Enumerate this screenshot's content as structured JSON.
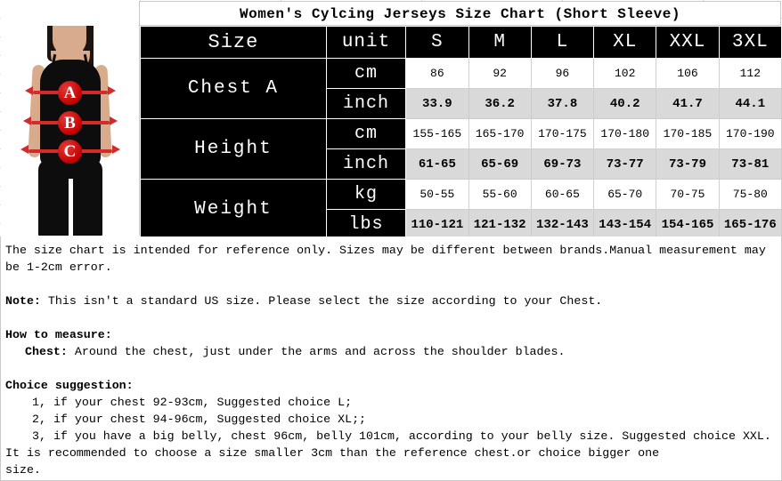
{
  "chart": {
    "title": "Women's Cylcing Jerseys Size Chart (Short Sleeve)",
    "header": {
      "size_label": "Size",
      "unit_label": "unit",
      "sizes": [
        "S",
        "M",
        "L",
        "XL",
        "XXL",
        "3XL"
      ]
    },
    "rows": [
      {
        "label": "Chest A",
        "units": [
          {
            "unit": "cm",
            "values": [
              "86",
              "92",
              "96",
              "102",
              "106",
              "112"
            ]
          },
          {
            "unit": "inch",
            "values": [
              "33.9",
              "36.2",
              "37.8",
              "40.2",
              "41.7",
              "44.1"
            ]
          }
        ]
      },
      {
        "label": "Height",
        "units": [
          {
            "unit": "cm",
            "values": [
              "155-165",
              "165-170",
              "170-175",
              "170-180",
              "170-185",
              "170-190"
            ]
          },
          {
            "unit": "inch",
            "values": [
              "61-65",
              "65-69",
              "69-73",
              "73-77",
              "73-79",
              "73-81"
            ]
          }
        ]
      },
      {
        "label": "Weight",
        "units": [
          {
            "unit": "kg",
            "values": [
              "50-55",
              "55-60",
              "60-65",
              "65-70",
              "70-75",
              "75-80"
            ]
          },
          {
            "unit": "lbs",
            "values": [
              "110-121",
              "121-132",
              "132-143",
              "143-154",
              "154-165",
              "165-176"
            ]
          }
        ]
      }
    ],
    "colors": {
      "header_bg": "#000000",
      "header_text": "#ffffff",
      "alt_row_bg": "#d9d9d9",
      "marker_red": "#c20000"
    }
  },
  "figure": {
    "markers": [
      "A",
      "B",
      "C"
    ],
    "alt": "woman wearing black tank top with red measurement bands labelled A, B and C"
  },
  "notes": {
    "disclaimer_line1": "The size chart is intended for reference only. Sizes may be different between brands.Manual measurement may",
    "disclaimer_line2": "be 1-2cm error.",
    "note_label": "Note:",
    "note_text": " This isn't a standard US size. Please select the size according to your Chest.",
    "how_to_measure_label": "How to measure:",
    "chest_label": "Chest:",
    "chest_text": " Around the chest, just under the arms and across the shoulder blades.",
    "choice_label": "Choice suggestion:",
    "choice_1": "1, if your chest 92-93cm, Suggested choice L;",
    "choice_2": "2, if your chest 94-96cm, Suggested choice XL;;",
    "choice_3": "3, if you have a big belly, chest 96cm, belly 101cm, according to your belly size. Suggested choice XXL.",
    "recommend_line1": "It is recommended to choose a size smaller 3cm than the reference chest.or choice bigger one",
    "recommend_line2": "size."
  }
}
